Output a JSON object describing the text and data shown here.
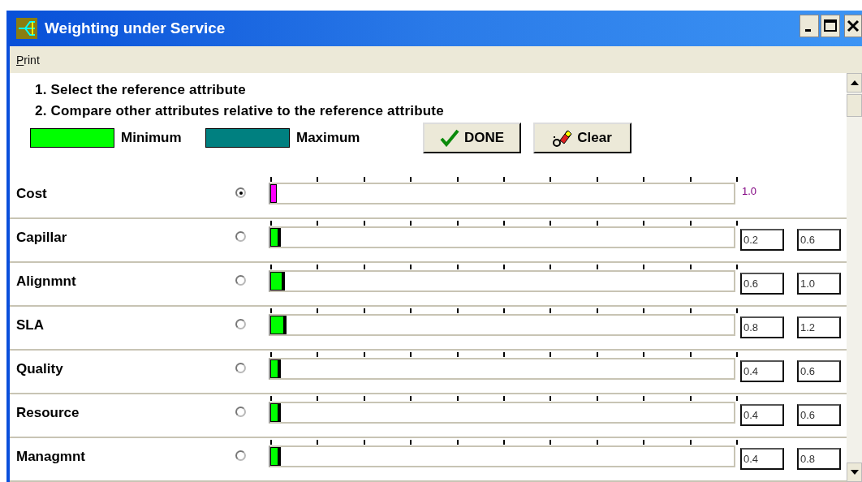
{
  "window": {
    "title": "Weighting under Service"
  },
  "menu": [
    {
      "label": "Print"
    }
  ],
  "instructions": [
    "1. Select the reference attribute",
    "2. Compare other attributes relative to the reference attribute"
  ],
  "legend": [
    {
      "label": "Minimum",
      "color": "#00ff00"
    },
    {
      "label": "Maximum",
      "color": "#008080"
    }
  ],
  "buttons": [
    {
      "label": "DONE",
      "kind": "done"
    },
    {
      "label": "Clear",
      "kind": "clear"
    }
  ],
  "attributes": [
    {
      "name": "Cost",
      "selected": true,
      "level": 0.014,
      "value": "1.0"
    },
    {
      "name": "Capillar",
      "selected": false,
      "level": 0.022,
      "min": "0.2",
      "max": "0.6"
    },
    {
      "name": "Alignmnt",
      "selected": false,
      "level": 0.032,
      "min": "0.6",
      "max": "1.0"
    },
    {
      "name": "SLA",
      "selected": false,
      "level": 0.035,
      "min": "0.8",
      "max": "1.2"
    },
    {
      "name": "Quality",
      "selected": false,
      "level": 0.022,
      "min": "0.4",
      "max": "0.6"
    },
    {
      "name": "Resource",
      "selected": false,
      "level": 0.022,
      "min": "0.4",
      "max": "0.6"
    },
    {
      "name": "Managmnt",
      "selected": false,
      "level": 0.022,
      "min": "0.4",
      "max": "0.8"
    }
  ]
}
